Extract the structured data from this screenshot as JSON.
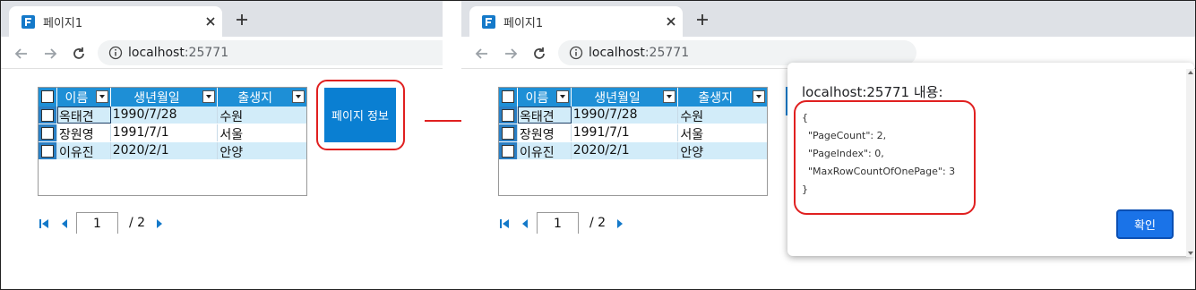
{
  "browser": {
    "tab_title": "페이지1",
    "url_host": "localhost",
    "url_port": ":25771"
  },
  "grid": {
    "headers": [
      "이름",
      "생년월일",
      "출생지"
    ],
    "rows": [
      [
        "옥태견",
        "1990/7/28",
        "수원"
      ],
      [
        "장원영",
        "1991/7/1",
        "서울"
      ],
      [
        "이유진",
        "2020/2/1",
        "안양"
      ]
    ]
  },
  "pager": {
    "current_page": "1",
    "total_label": "/ 2"
  },
  "page_info_button": "페이지 정보",
  "dialog": {
    "title": "localhost:25771 내용:",
    "lines": [
      "{",
      "  \"PageCount\": 2,",
      "  \"PageIndex\": 0,",
      "  \"MaxRowCountOfOnePage\": 3",
      "}"
    ],
    "ok_label": "확인"
  },
  "colors": {
    "grid_header": "#1e8fd6",
    "grid_alt_row": "#d2ecf9",
    "button_blue": "#0a7fd2",
    "highlight_red": "#e02020",
    "dialog_button": "#1a73e8"
  }
}
